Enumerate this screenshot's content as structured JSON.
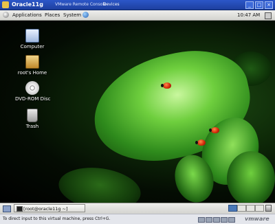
{
  "vm_window": {
    "title": "Oracle11g",
    "subtitle": "VMware Remote Console",
    "devices_menu": "Devices"
  },
  "top_panel": {
    "menus": [
      "Applications",
      "Places",
      "System"
    ],
    "clock": "10:47 AM"
  },
  "desktop_icons": [
    {
      "label": "Computer",
      "icon": "computer-icon"
    },
    {
      "label": "root's Home",
      "icon": "home-folder-icon"
    },
    {
      "label": "DVD-ROM Disc",
      "icon": "dvd-disc-icon"
    },
    {
      "label": "Trash",
      "icon": "trash-icon"
    }
  ],
  "bottom_panel": {
    "task": "[root@oracle11g ~]"
  },
  "status_bar": {
    "message": "To direct input to this virtual machine, press Ctrl+G.",
    "logo": "vmware"
  },
  "colors": {
    "title_bar": "#1d3f9e",
    "active_workspace": "#4a78b8"
  }
}
